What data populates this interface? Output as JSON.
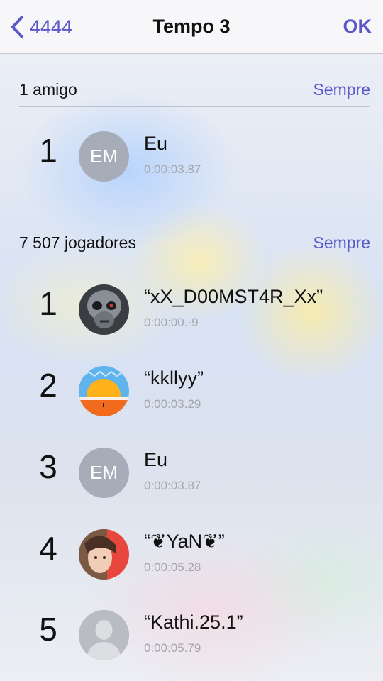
{
  "nav": {
    "back_label": "4444",
    "title": "Tempo 3",
    "ok_label": "OK"
  },
  "friends_section": {
    "count_label": "1 amigo",
    "filter_label": "Sempre"
  },
  "friends": [
    {
      "rank": "1",
      "initials": "EM",
      "name": "Eu",
      "time": "0:00:03.87"
    }
  ],
  "players_section": {
    "count_label": "7 507 jogadores",
    "filter_label": "Sempre"
  },
  "players": [
    {
      "rank": "1",
      "avatar": "skull-avatar",
      "name": "“xX_D00MST4R_Xx”",
      "time": "0:00:00.-9"
    },
    {
      "rank": "2",
      "avatar": "sunset-avatar",
      "name": "“kkllyy”",
      "time": "0:00:03.29"
    },
    {
      "rank": "3",
      "initials": "EM",
      "name": "Eu",
      "time": "0:00:03.87"
    },
    {
      "rank": "4",
      "avatar": "photo-avatar",
      "name": "“❦YaN❦”",
      "time": "0:00:05.28"
    },
    {
      "rank": "5",
      "avatar": "person-silhouette-avatar",
      "name": "“Kathi.25.1”",
      "time": "0:00:05.79"
    }
  ],
  "colors": {
    "accent": "#5b58c8",
    "text": "#111111",
    "secondary_text": "#a3a6ad",
    "initials_avatar_bg": "#a6adb9"
  }
}
